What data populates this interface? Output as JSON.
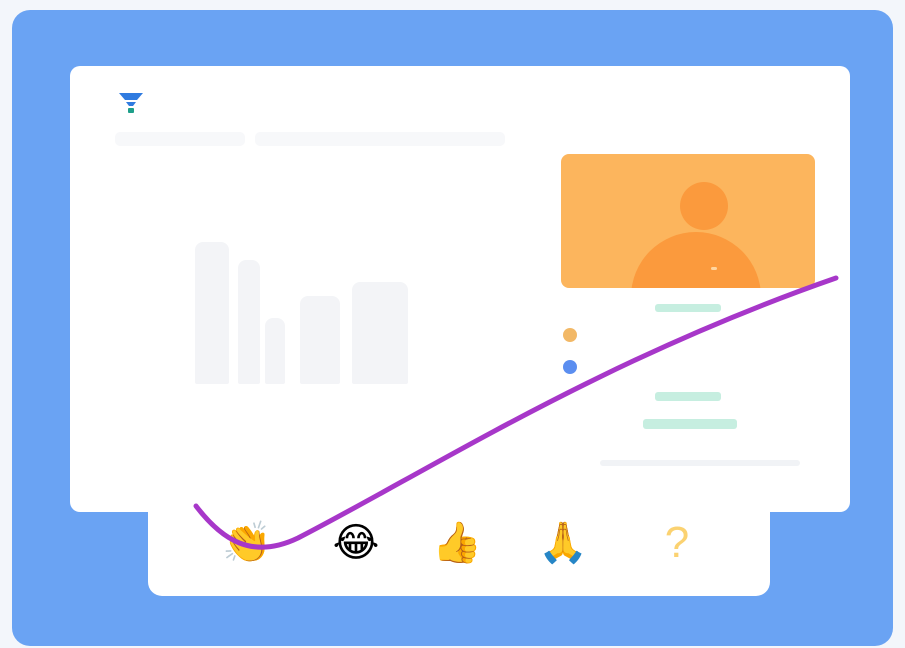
{
  "colors": {
    "frame": "#6aa3f3",
    "window": "#ffffff",
    "video_tile": "#fcb55d",
    "person": "#fb9a3d",
    "dot_orange": "#f2b866",
    "dot_blue": "#5b8ef0",
    "mint": "#c6eee0",
    "annotation_stroke": "#a737c9",
    "logo": "#2f7be0"
  },
  "icons": {
    "logo": "funnel-logo-icon",
    "video_participant": "person-avatar-icon"
  },
  "reactions": [
    {
      "name": "clap-reaction",
      "glyph": "👏"
    },
    {
      "name": "laugh-reaction",
      "glyph": "😂"
    },
    {
      "name": "thumbs-up-reaction",
      "glyph": "👍"
    },
    {
      "name": "pray-reaction",
      "glyph": "🙏"
    },
    {
      "name": "question-reaction",
      "glyph": "?"
    }
  ]
}
